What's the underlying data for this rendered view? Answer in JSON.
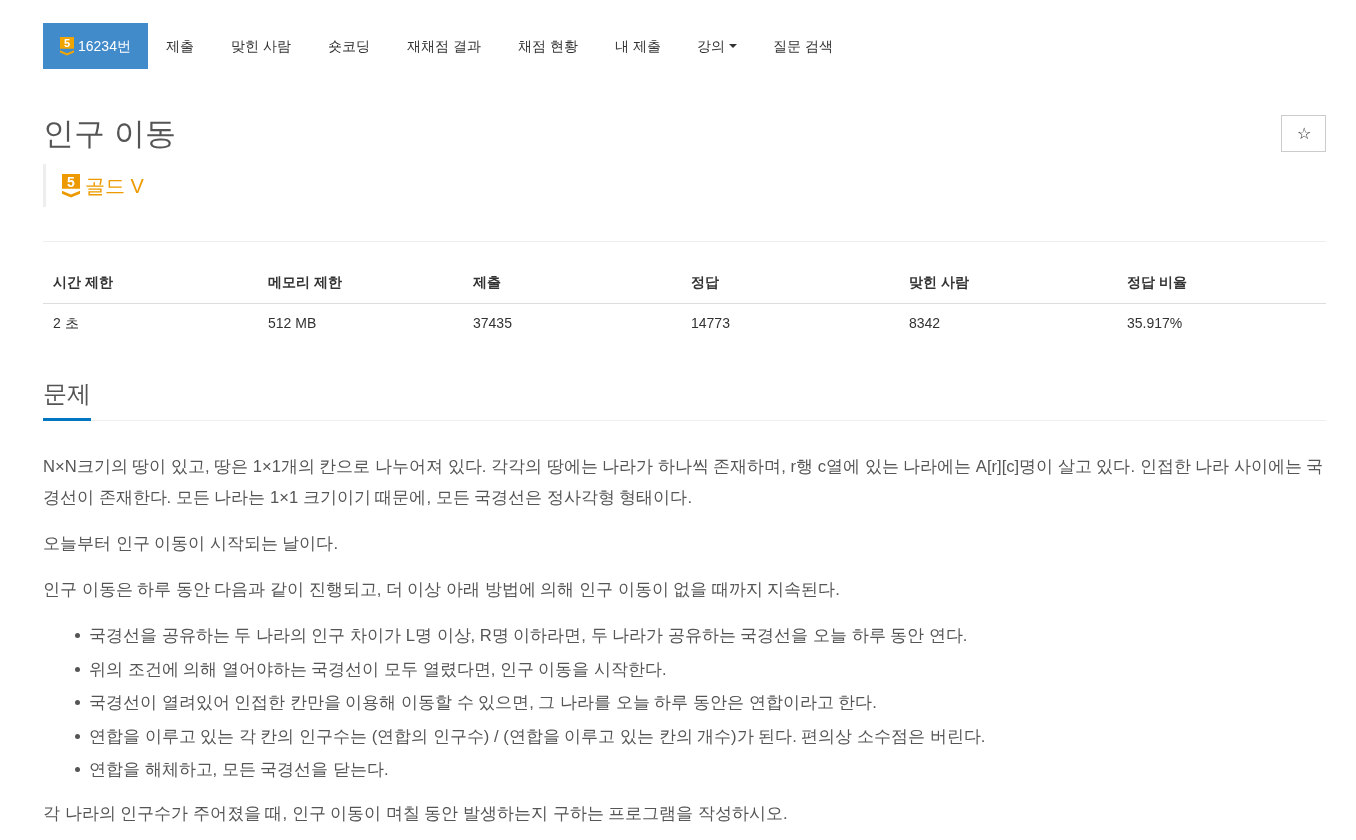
{
  "nav": {
    "items": [
      {
        "kind": "problem",
        "badge": "5",
        "label": "16234번",
        "selected": true
      },
      {
        "kind": "link",
        "label": "제출",
        "selected": false
      },
      {
        "kind": "link",
        "label": "맞힌 사람",
        "selected": false
      },
      {
        "kind": "link",
        "label": "숏코딩",
        "selected": false
      },
      {
        "kind": "link",
        "label": "재채점 결과",
        "selected": false
      },
      {
        "kind": "link",
        "label": "채점 현황",
        "selected": false
      },
      {
        "kind": "link",
        "label": "내 제출",
        "selected": false
      },
      {
        "kind": "dropdown",
        "label": "강의",
        "selected": false
      },
      {
        "kind": "link",
        "label": "질문 검색",
        "selected": false
      }
    ]
  },
  "problem": {
    "title": "인구 이동",
    "star": "☆",
    "tier": {
      "badge": "5",
      "label": "골드 V"
    }
  },
  "info_table": {
    "columns": [
      "시간 제한",
      "메모리 제한",
      "제출",
      "정답",
      "맞힌 사람",
      "정답 비율"
    ],
    "rows": [
      [
        "2 초",
        "512 MB",
        "37435",
        "14773",
        "8342",
        "35.917%"
      ]
    ]
  },
  "sections": [
    {
      "heading": "문제",
      "blocks": [
        {
          "kind": "paragraph",
          "text": "N×N크기의 땅이 있고, 땅은 1×1개의 칸으로 나누어져 있다. 각각의 땅에는 나라가 하나씩 존재하며, r행 c열에 있는 나라에는 A[r][c]명이 살고 있다. 인접한 나라 사이에는 국경선이 존재한다. 모든 나라는 1×1 크기이기 때문에, 모든 국경선은 정사각형 형태이다."
        },
        {
          "kind": "paragraph",
          "text": "오늘부터 인구 이동이 시작되는 날이다."
        },
        {
          "kind": "paragraph",
          "text": "인구 이동은 하루 동안 다음과 같이 진행되고, 더 이상 아래 방법에 의해 인구 이동이 없을 때까지 지속된다."
        },
        {
          "kind": "list",
          "items": [
            "국경선을 공유하는 두 나라의 인구 차이가 L명 이상, R명 이하라면, 두 나라가 공유하는 국경선을 오늘 하루 동안 연다.",
            "위의 조건에 의해 열어야하는 국경선이 모두 열렸다면, 인구 이동을 시작한다.",
            "국경선이 열려있어 인접한 칸만을 이용해 이동할 수 있으면, 그 나라를 오늘 하루 동안은 연합이라고 한다.",
            "연합을 이루고 있는 각 칸의 인구수는 (연합의 인구수) / (연합을 이루고 있는 칸의 개수)가 된다. 편의상 소수점은 버린다.",
            "연합을 해체하고, 모든 국경선을 닫는다."
          ]
        },
        {
          "kind": "paragraph",
          "text": "각 나라의 인구수가 주어졌을 때, 인구 이동이 며칠 동안 발생하는지 구하는 프로그램을 작성하시오."
        }
      ]
    }
  ]
}
